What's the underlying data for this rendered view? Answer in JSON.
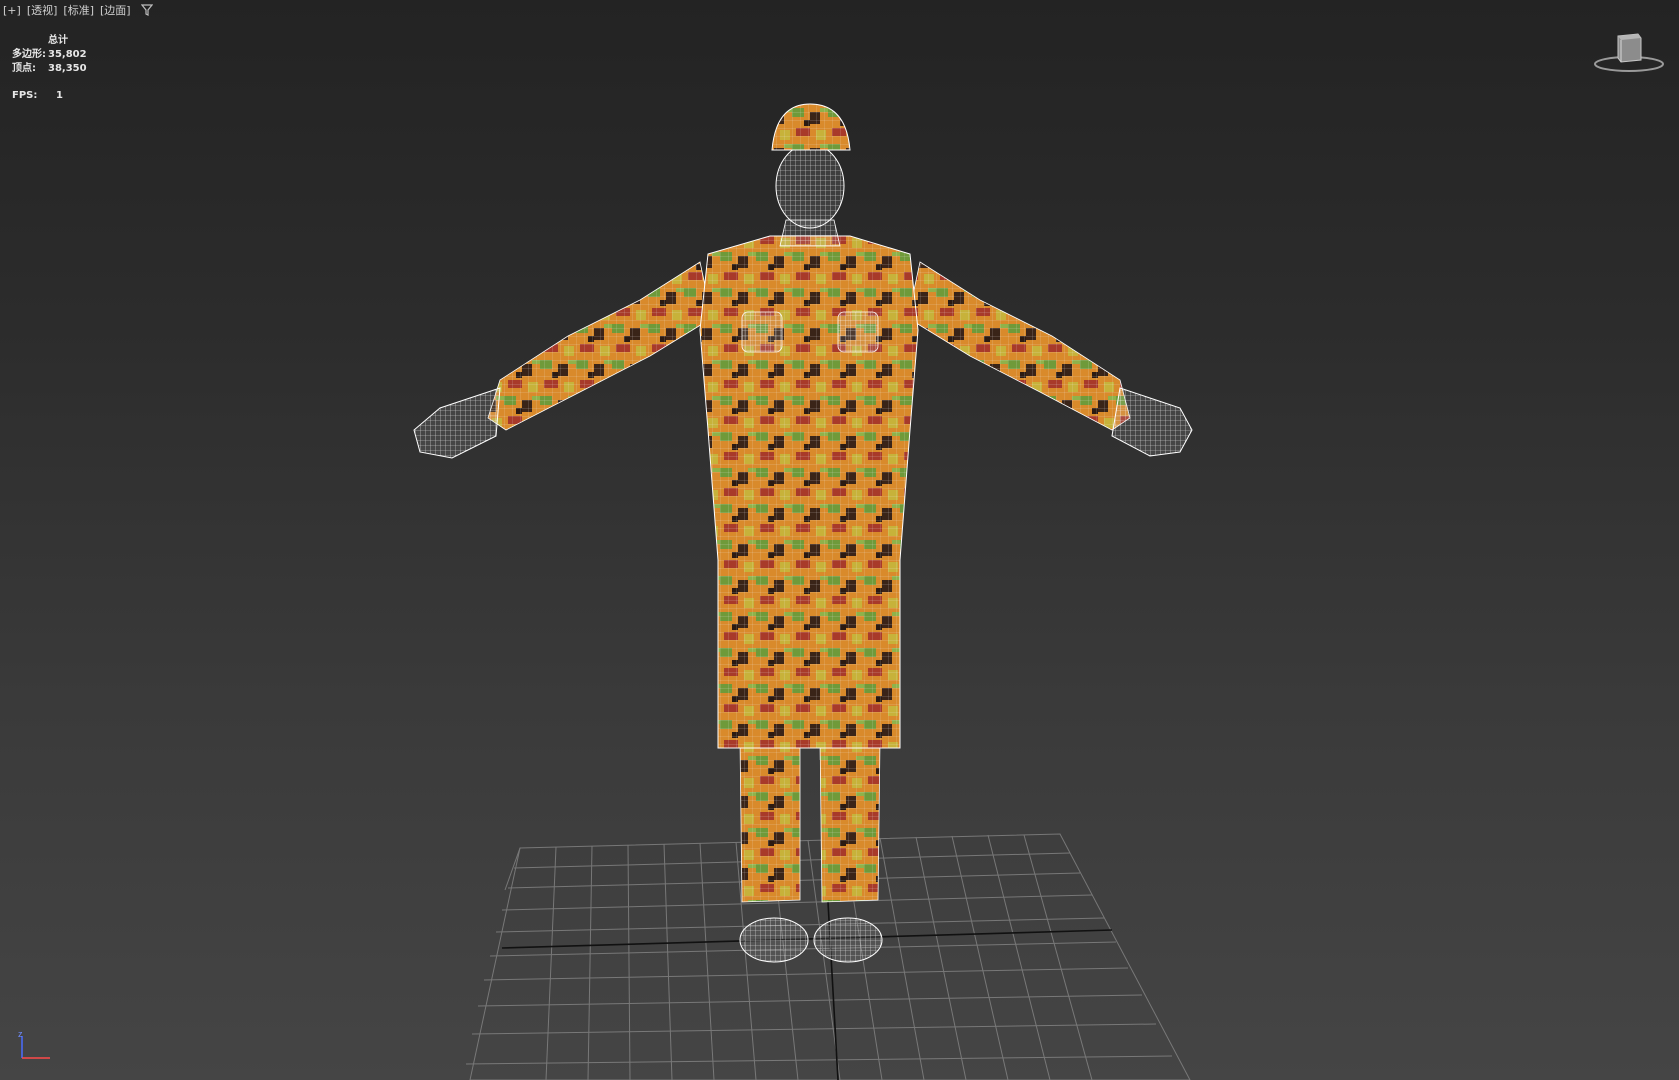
{
  "viewport": {
    "menu": [
      "[+]",
      "[透视]",
      "[标准]",
      "[边面]"
    ],
    "stats": {
      "header": "总计",
      "polys_label": "多边形:",
      "polys_value": "35,802",
      "verts_label": "顶点:",
      "verts_value": "38,350",
      "fps_label": "FPS:",
      "fps_value": "1"
    },
    "axis_label": "z",
    "icons": [
      "filter-icon",
      "viewcube-icon",
      "axis-tripod-icon"
    ],
    "colors": {
      "background_top": "#232323",
      "background_bottom": "#454545",
      "grid": "#8a8a8a",
      "wireframe": "#f2f2f2",
      "fabric_orange": "#d98a2b",
      "fabric_green": "#6f9a3a",
      "fabric_dark": "#3a2418",
      "fabric_red": "#a83a2a"
    }
  }
}
